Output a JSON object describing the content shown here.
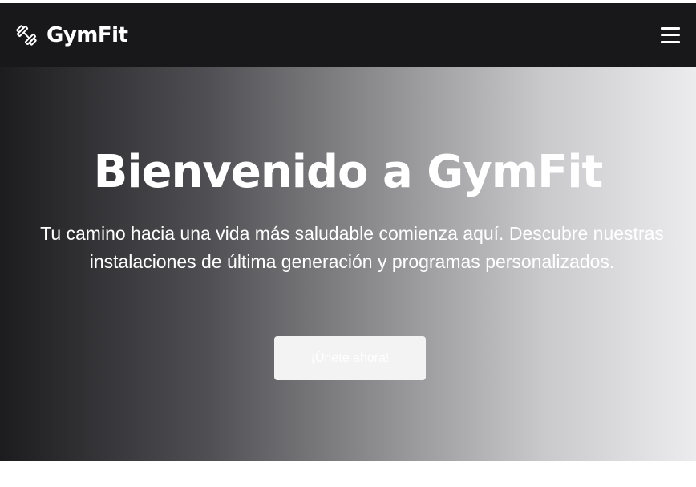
{
  "navbar": {
    "brand_name": "GymFit",
    "brand_icon": "dumbbell-icon",
    "menu_icon": "hamburger-menu-icon"
  },
  "hero": {
    "title": "Bienvenido a GymFit",
    "subtitle": "Tu camino hacia una vida más saludable comienza aquí. Descubre nuestras instalaciones de última generación y programas personalizados.",
    "cta_label": "¡Únete ahora!"
  },
  "colors": {
    "navbar_background": "#18181b",
    "hero_gradient_start": "#1c1c1f",
    "hero_gradient_end": "#ececee",
    "text": "#ffffff",
    "button_background": "#f3f3f4"
  }
}
